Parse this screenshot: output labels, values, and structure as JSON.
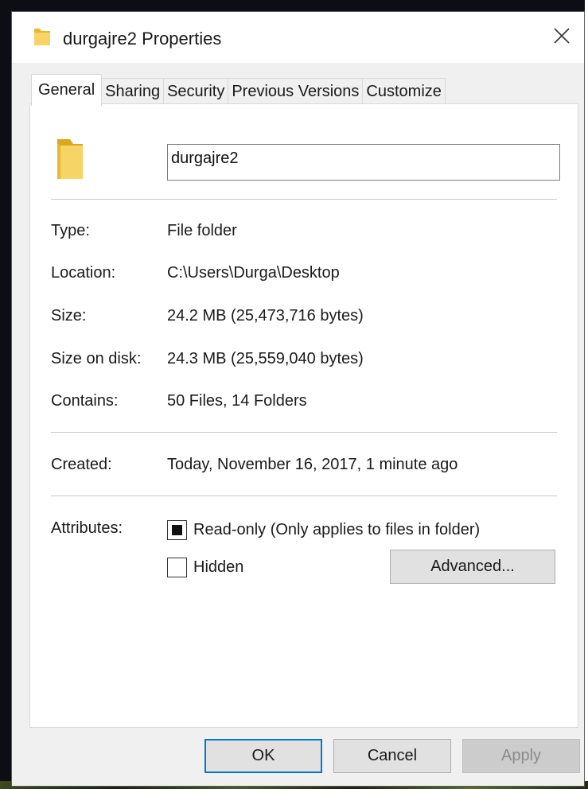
{
  "window": {
    "title": "durgajre2 Properties",
    "title_icon": "folder-icon",
    "close_icon": "close-icon"
  },
  "tabs": [
    {
      "label": "General",
      "active": true
    },
    {
      "label": "Sharing",
      "active": false
    },
    {
      "label": "Security",
      "active": false
    },
    {
      "label": "Previous Versions",
      "active": false
    },
    {
      "label": "Customize",
      "active": false
    }
  ],
  "general": {
    "folder_icon": "folder-icon",
    "name_value": "durgajre2",
    "type": {
      "label": "Type:",
      "value": "File folder"
    },
    "location": {
      "label": "Location:",
      "value": "C:\\Users\\Durga\\Desktop"
    },
    "size": {
      "label": "Size:",
      "value": "24.2 MB (25,473,716 bytes)"
    },
    "size_on_disk": {
      "label": "Size on disk:",
      "value": "24.3 MB (25,559,040 bytes)"
    },
    "contains": {
      "label": "Contains:",
      "value": "50 Files, 14 Folders"
    },
    "created": {
      "label": "Created:",
      "value": "Today, November 16, 2017, 1 minute ago"
    },
    "attributes": {
      "label": "Attributes:",
      "readonly": {
        "label": "Read-only (Only applies to files in folder)",
        "state": "indeterminate"
      },
      "hidden": {
        "label": "Hidden",
        "state": "unchecked"
      },
      "advanced_label": "Advanced..."
    }
  },
  "buttons": {
    "ok": "OK",
    "cancel": "Cancel",
    "apply": "Apply"
  },
  "colors": {
    "focus_accent": "#0078d7",
    "folder_yellow": "#f6d465"
  }
}
